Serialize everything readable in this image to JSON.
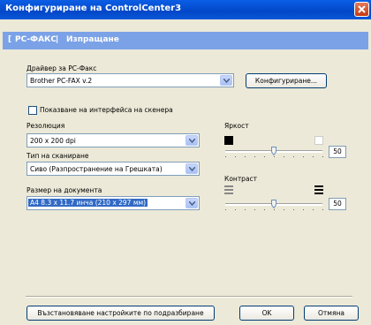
{
  "window": {
    "title": "Конфигуриране на ControlCenter3"
  },
  "tabs": {
    "tab1": "PC-ФАКС",
    "separator": "|",
    "tab2": "Изпращане",
    "lead": "["
  },
  "fax_driver": {
    "label": "Драйвер за PC-Факс",
    "value": "Brother PC-FAX v.2",
    "configure_button": "Конфигуриране..."
  },
  "scanner": {
    "show_interface_label": "Показване на интерфейса на скенера",
    "show_interface_checked": false,
    "resolution_label": "Резолюция",
    "resolution_value": "200 x 200 dpi",
    "scan_type_label": "Тип на сканиране",
    "scan_type_value": "Сиво (Разпространение на Грешката)",
    "doc_size_label": "Размер на документа",
    "doc_size_value": "A4 8.3 x 11.7 инча (210 x 297 мм)"
  },
  "brightness": {
    "label": "Яркост",
    "value": "50",
    "level_percent": 50
  },
  "contrast": {
    "label": "Контраст",
    "value": "50",
    "level_percent": 50
  },
  "footer": {
    "restore_button": "Възстановяване настройките по подразбиране",
    "ok_button": "OK",
    "cancel_button": "Отмяна"
  }
}
